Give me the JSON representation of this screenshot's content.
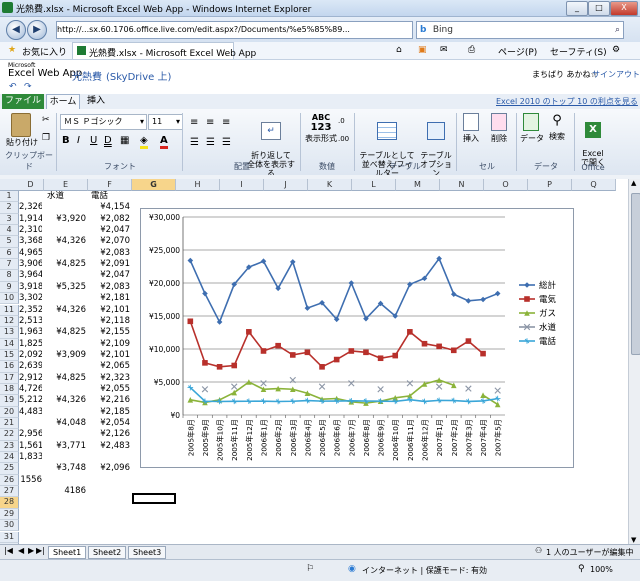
{
  "window": {
    "title": "光熱費.xlsx - Microsoft Excel Web App - Windows Internet Explorer",
    "min": "_",
    "max": "□",
    "close": "X"
  },
  "browser": {
    "address": "http://...sx.60.1706.office.live.com/edit.aspx?/Documents/%e5%85%89...",
    "search_engine": "Bing",
    "favorites_label": "お気に入り",
    "tab_label": "光熱費.xlsx - Microsoft Excel Web App",
    "page_menu": "ページ(P)",
    "safety_menu": "セーフティ(S)"
  },
  "app": {
    "brand_small": "Microsoft",
    "brand": "Excel Web App",
    "doc_name": "光熱費",
    "location": "(SkyDrive 上)",
    "user": "まちばり あかね☆",
    "signout": "サインアウト",
    "promo": "Excel 2010 のトップ 10 の利点を見る"
  },
  "ribbon": {
    "tabs": [
      "ファイル",
      "ホーム",
      "挿入"
    ],
    "paste": "貼り付け",
    "font_name": "ＭＳ Ｐゴシック",
    "font_size": "11",
    "wrap": "折り返して\n全体を表示する",
    "number_format": "表示形式",
    "table_format": "テーブルとして\n並べ替え/フィルター",
    "table_options": "テーブル\nオプション",
    "insert": "挿入",
    "delete": "削除",
    "data": "データ",
    "find": "検索",
    "open_excel": "Excel\nで開く",
    "groups": {
      "clipboard": "クリップボード",
      "font": "フォント",
      "alignment": "配置",
      "number": "数値",
      "tables": "テーブル",
      "cells": "セル",
      "data": "データ",
      "office": "Office"
    },
    "abc": "ABC",
    "num": "123"
  },
  "grid": {
    "columns": [
      "D",
      "E",
      "F",
      "G",
      "H",
      "I",
      "J",
      "K",
      "L",
      "M",
      "N",
      "O",
      "P",
      "Q"
    ],
    "selected_col": "G",
    "rows": [
      {
        "n": "1",
        "d": "",
        "e": "水道",
        "f": "電話"
      },
      {
        "n": "2",
        "d": "2,326",
        "e": "",
        "f": "¥4,154"
      },
      {
        "n": "3",
        "d": "1,914",
        "e": "¥3,920",
        "f": "¥2,082"
      },
      {
        "n": "4",
        "d": "2,310",
        "e": "",
        "f": "¥2,047"
      },
      {
        "n": "5",
        "d": "3,368",
        "e": "¥4,326",
        "f": "¥2,070"
      },
      {
        "n": "6",
        "d": "4,965",
        "e": "",
        "f": "¥2,083"
      },
      {
        "n": "7",
        "d": "3,906",
        "e": "¥4,825",
        "f": "¥2,091"
      },
      {
        "n": "8",
        "d": "3,964",
        "e": "",
        "f": "¥2,047"
      },
      {
        "n": "9",
        "d": "3,918",
        "e": "¥5,325",
        "f": "¥2,083"
      },
      {
        "n": "10",
        "d": "3,302",
        "e": "",
        "f": "¥2,181"
      },
      {
        "n": "11",
        "d": "2,352",
        "e": "¥4,326",
        "f": "¥2,101"
      },
      {
        "n": "12",
        "d": "2,513",
        "e": "",
        "f": "¥2,118"
      },
      {
        "n": "13",
        "d": "1,963",
        "e": "¥4,825",
        "f": "¥2,155"
      },
      {
        "n": "14",
        "d": "1,825",
        "e": "",
        "f": "¥2,109"
      },
      {
        "n": "15",
        "d": "2,092",
        "e": "¥3,909",
        "f": "¥2,101"
      },
      {
        "n": "16",
        "d": "2,639",
        "e": "",
        "f": "¥2,065"
      },
      {
        "n": "17",
        "d": "2,912",
        "e": "¥4,825",
        "f": "¥2,323"
      },
      {
        "n": "18",
        "d": "4,726",
        "e": "",
        "f": "¥2,055"
      },
      {
        "n": "19",
        "d": "5,212",
        "e": "¥4,326",
        "f": "¥2,216"
      },
      {
        "n": "20",
        "d": "4,483",
        "e": "",
        "f": "¥2,185"
      },
      {
        "n": "21",
        "d": "",
        "e": "¥4,048",
        "f": "¥2,054"
      },
      {
        "n": "22",
        "d": "2,956",
        "e": "",
        "f": "¥2,126"
      },
      {
        "n": "23",
        "d": "1,561",
        "e": "¥3,771",
        "f": "¥2,483"
      },
      {
        "n": "24",
        "d": "1,833",
        "e": "",
        "f": ""
      },
      {
        "n": "25",
        "d": "",
        "e": "¥3,748",
        "f": "¥2,096"
      },
      {
        "n": "26",
        "d": "1556",
        "e": "",
        "f": ""
      },
      {
        "n": "27",
        "d": "",
        "e": "4186",
        "f": ""
      },
      {
        "n": "28",
        "d": "",
        "e": "",
        "f": ""
      },
      {
        "n": "29",
        "d": "",
        "e": "",
        "f": ""
      },
      {
        "n": "30",
        "d": "",
        "e": "",
        "f": ""
      },
      {
        "n": "31",
        "d": "",
        "e": "",
        "f": ""
      },
      {
        "n": "32",
        "d": "",
        "e": "",
        "f": ""
      }
    ]
  },
  "sheets": [
    "Sheet1",
    "Sheet2",
    "Sheet3"
  ],
  "status": {
    "editors": "1 人のユーザーが編集中",
    "zone": "インターネット | 保護モード: 有効",
    "zoom": "100%"
  },
  "chart_data": {
    "type": "line",
    "title": "",
    "ylim": [
      0,
      30000
    ],
    "yticks": [
      "¥0",
      "¥5,000",
      "¥10,000",
      "¥15,000",
      "¥20,000",
      "¥25,000",
      "¥30,000"
    ],
    "grid": true,
    "legend_position": "right",
    "categories": [
      "2005年8月",
      "2005年9月",
      "2005年10月",
      "2005年11月",
      "2005年12月",
      "2006年1月",
      "2006年2月",
      "2006年3月",
      "2006年4月",
      "2006年5月",
      "2006年6月",
      "2006年7月",
      "2006年8月",
      "2006年9月",
      "2006年10月",
      "2006年11月",
      "2006年12月",
      "2007年1月",
      "2007年2月",
      "2007年3月",
      "2007年4月",
      "2007年5月"
    ],
    "series": [
      {
        "name": "総計",
        "color": "#3e6eb0",
        "marker": "diamond",
        "values": [
          23400,
          18400,
          14100,
          19800,
          22400,
          23300,
          19200,
          23200,
          16200,
          17000,
          14500,
          20000,
          14600,
          16900,
          15000,
          19800,
          20700,
          23700,
          18300,
          17300,
          17500,
          18400
        ]
      },
      {
        "name": "電気",
        "color": "#b8302b",
        "marker": "square",
        "values": [
          14200,
          7900,
          7300,
          7500,
          12600,
          9700,
          10500,
          9100,
          9500,
          7300,
          8400,
          9700,
          9500,
          8600,
          9000,
          12600,
          10800,
          10400,
          9800,
          11200,
          9300
        ]
      },
      {
        "name": "ガス",
        "color": "#8bb33a",
        "marker": "triangle",
        "values": [
          2300,
          1900,
          2300,
          3400,
          5000,
          3900,
          4000,
          3900,
          3300,
          2400,
          2500,
          2000,
          1800,
          2100,
          2600,
          2900,
          4700,
          5300,
          4500,
          null,
          3000,
          1600
        ]
      },
      {
        "name": "水道",
        "color": "#8c96a6",
        "marker": "x",
        "values": [
          null,
          3900,
          null,
          4300,
          null,
          4800,
          null,
          5300,
          null,
          4300,
          null,
          4800,
          null,
          3900,
          null,
          4800,
          null,
          4300,
          null,
          4000,
          null,
          3700
        ]
      },
      {
        "name": "電話",
        "color": "#3aa6d8",
        "marker": "star",
        "values": [
          4154,
          2082,
          2047,
          2070,
          2083,
          2091,
          2047,
          2083,
          2181,
          2101,
          2118,
          2155,
          2109,
          2101,
          2065,
          2323,
          2055,
          2216,
          2185,
          2054,
          2126,
          2483
        ]
      }
    ]
  }
}
